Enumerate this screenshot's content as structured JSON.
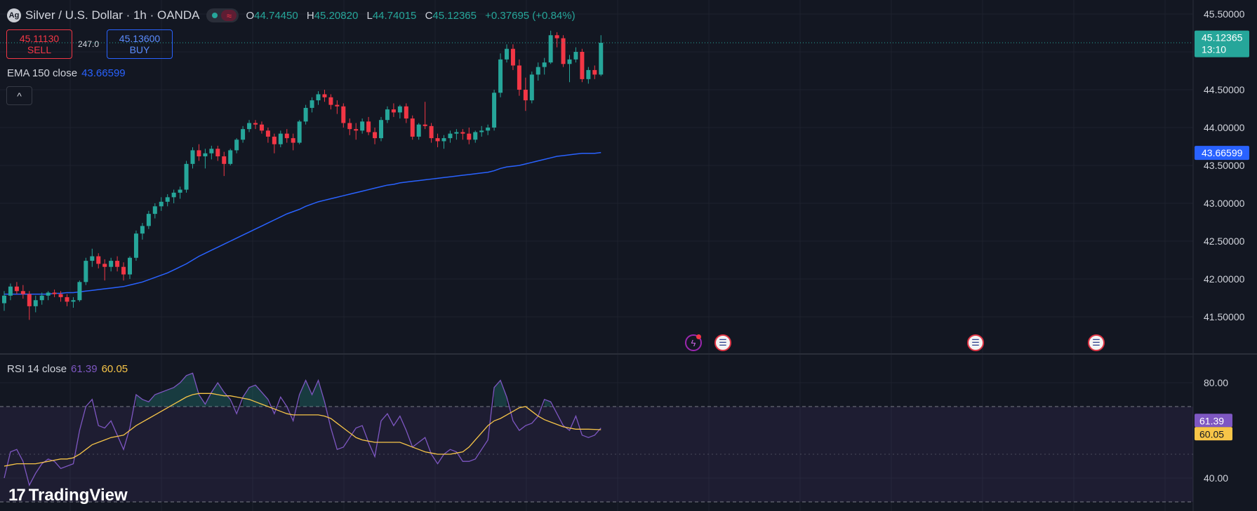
{
  "header": {
    "title": "Silver / U.S. Dollar · 1h · OANDA",
    "ohlc": [
      {
        "k": "O",
        "v": "44.74450"
      },
      {
        "k": "H",
        "v": "45.20820"
      },
      {
        "k": "L",
        "v": "44.74015"
      },
      {
        "k": "C",
        "v": "45.12365"
      }
    ],
    "change": "+0.37695 (+0.84%)"
  },
  "trade": {
    "sell_price": "45.11130",
    "sell_label": "SELL",
    "spread": "247.0",
    "buy_price": "45.13600",
    "buy_label": "BUY"
  },
  "legend": {
    "ema_label": "EMA 150 close",
    "ema_value": "43.66599",
    "rsi_label": "RSI 14 close",
    "rsi_value": "61.39",
    "rsi_ma_value": "60.05"
  },
  "collapse_label": "^",
  "brand": "TradingView",
  "colors": {
    "background": "#131722",
    "up": "#26a69a",
    "down": "#f23645",
    "ema": "#2962ff",
    "rsi": "#7e57c2",
    "rsi_ma": "#f7c548"
  },
  "events": [
    "lightning-icon",
    "us-flag-icon",
    "us-flag-icon",
    "us-flag-icon"
  ],
  "chart_data": [
    {
      "type": "candlestick",
      "title": "Silver / U.S. Dollar · 1h · OANDA",
      "y_ticks": [
        "45.50000",
        "45.00000",
        "44.50000",
        "44.00000",
        "43.50000",
        "43.00000",
        "42.50000",
        "42.00000",
        "41.50000"
      ],
      "ylim": [
        41.1,
        45.65
      ],
      "price_tag": {
        "value": "45.12365",
        "countdown": "13:10"
      },
      "ema_tag": "43.66599",
      "grid": true,
      "candles": [
        [
          41.68,
          41.84,
          41.58,
          41.78
        ],
        [
          41.78,
          41.94,
          41.72,
          41.9
        ],
        [
          41.9,
          41.96,
          41.8,
          41.84
        ],
        [
          41.84,
          41.92,
          41.74,
          41.8
        ],
        [
          41.8,
          41.84,
          41.46,
          41.64
        ],
        [
          41.64,
          41.78,
          41.56,
          41.72
        ],
        [
          41.72,
          41.82,
          41.66,
          41.78
        ],
        [
          41.78,
          41.84,
          41.72,
          41.82
        ],
        [
          41.82,
          41.86,
          41.76,
          41.8
        ],
        [
          41.8,
          41.84,
          41.7,
          41.76
        ],
        [
          41.76,
          41.8,
          41.64,
          41.7
        ],
        [
          41.7,
          41.76,
          41.62,
          41.72
        ],
        [
          41.72,
          41.98,
          41.7,
          41.96
        ],
        [
          41.96,
          42.28,
          41.92,
          42.24
        ],
        [
          42.24,
          42.4,
          42.16,
          42.3
        ],
        [
          42.3,
          42.34,
          42.14,
          42.2
        ],
        [
          42.2,
          42.26,
          41.98,
          42.16
        ],
        [
          42.16,
          42.28,
          42.1,
          42.24
        ],
        [
          42.24,
          42.3,
          42.1,
          42.16
        ],
        [
          42.16,
          42.22,
          41.98,
          42.06
        ],
        [
          42.06,
          42.3,
          42.0,
          42.28
        ],
        [
          42.28,
          42.64,
          42.24,
          42.6
        ],
        [
          42.6,
          42.74,
          42.52,
          42.7
        ],
        [
          42.7,
          42.9,
          42.66,
          42.86
        ],
        [
          42.86,
          43.0,
          42.8,
          42.96
        ],
        [
          42.96,
          43.08,
          42.9,
          43.02
        ],
        [
          43.02,
          43.12,
          42.96,
          43.08
        ],
        [
          43.08,
          43.18,
          43.0,
          43.14
        ],
        [
          43.14,
          43.22,
          43.06,
          43.18
        ],
        [
          43.18,
          43.56,
          43.14,
          43.52
        ],
        [
          43.52,
          43.74,
          43.46,
          43.7
        ],
        [
          43.7,
          43.78,
          43.56,
          43.62
        ],
        [
          43.62,
          43.72,
          43.46,
          43.66
        ],
        [
          43.66,
          43.76,
          43.58,
          43.72
        ],
        [
          43.72,
          43.76,
          43.56,
          43.62
        ],
        [
          43.62,
          43.68,
          43.36,
          43.52
        ],
        [
          43.52,
          43.72,
          43.5,
          43.7
        ],
        [
          43.7,
          43.86,
          43.66,
          43.84
        ],
        [
          43.84,
          44.02,
          43.8,
          43.98
        ],
        [
          43.98,
          44.1,
          43.94,
          44.06
        ],
        [
          44.06,
          44.1,
          43.98,
          44.04
        ],
        [
          44.04,
          44.08,
          43.92,
          43.96
        ],
        [
          43.96,
          44.0,
          43.8,
          43.88
        ],
        [
          43.88,
          43.92,
          43.66,
          43.78
        ],
        [
          43.78,
          43.96,
          43.74,
          43.92
        ],
        [
          43.92,
          43.98,
          43.8,
          43.86
        ],
        [
          43.86,
          43.92,
          43.7,
          43.8
        ],
        [
          43.8,
          44.1,
          43.78,
          44.08
        ],
        [
          44.08,
          44.3,
          44.04,
          44.26
        ],
        [
          44.26,
          44.4,
          44.2,
          44.36
        ],
        [
          44.36,
          44.48,
          44.3,
          44.44
        ],
        [
          44.44,
          44.5,
          44.34,
          44.4
        ],
        [
          44.4,
          44.44,
          44.24,
          44.3
        ],
        [
          44.3,
          44.36,
          44.18,
          44.28
        ],
        [
          44.28,
          44.32,
          44.0,
          44.06
        ],
        [
          44.06,
          44.12,
          43.9,
          43.98
        ],
        [
          43.98,
          44.06,
          43.84,
          43.96
        ],
        [
          43.96,
          44.12,
          43.92,
          44.08
        ],
        [
          44.08,
          44.14,
          43.9,
          43.94
        ],
        [
          43.94,
          44.0,
          43.78,
          43.86
        ],
        [
          43.86,
          44.14,
          43.82,
          44.1
        ],
        [
          44.1,
          44.28,
          44.06,
          44.24
        ],
        [
          44.24,
          44.32,
          44.14,
          44.2
        ],
        [
          44.2,
          44.3,
          44.12,
          44.28
        ],
        [
          44.28,
          44.32,
          44.06,
          44.12
        ],
        [
          44.12,
          44.16,
          43.84,
          43.88
        ],
        [
          43.88,
          44.06,
          43.84,
          44.04
        ],
        [
          44.04,
          44.34,
          43.98,
          44.02
        ],
        [
          44.02,
          44.06,
          43.8,
          43.86
        ],
        [
          43.86,
          43.92,
          43.74,
          43.82
        ],
        [
          43.82,
          43.9,
          43.72,
          43.86
        ],
        [
          43.86,
          43.96,
          43.8,
          43.92
        ],
        [
          43.92,
          43.98,
          43.84,
          43.94
        ],
        [
          43.94,
          43.98,
          43.84,
          43.92
        ],
        [
          43.92,
          44.0,
          43.78,
          43.84
        ],
        [
          43.84,
          43.96,
          43.8,
          43.94
        ],
        [
          43.94,
          44.02,
          43.88,
          43.96
        ],
        [
          43.96,
          44.04,
          43.9,
          44.0
        ],
        [
          44.0,
          44.5,
          43.96,
          44.46
        ],
        [
          44.46,
          44.98,
          44.4,
          44.9
        ],
        [
          44.9,
          45.1,
          44.86,
          45.04
        ],
        [
          45.04,
          45.1,
          44.76,
          44.82
        ],
        [
          44.82,
          44.9,
          44.42,
          44.5
        ],
        [
          44.5,
          44.66,
          44.22,
          44.36
        ],
        [
          44.36,
          44.74,
          44.32,
          44.7
        ],
        [
          44.7,
          44.86,
          44.62,
          44.8
        ],
        [
          44.8,
          44.92,
          44.7,
          44.86
        ],
        [
          44.86,
          45.28,
          44.84,
          45.22
        ],
        [
          45.22,
          45.26,
          45.06,
          45.18
        ],
        [
          45.18,
          45.22,
          44.8,
          44.84
        ],
        [
          44.84,
          44.96,
          44.6,
          44.9
        ],
        [
          44.9,
          45.06,
          44.86,
          45.0
        ],
        [
          45.0,
          45.04,
          44.6,
          44.64
        ],
        [
          44.64,
          44.8,
          44.58,
          44.76
        ],
        [
          44.76,
          44.82,
          44.64,
          44.7
        ],
        [
          44.7,
          45.22,
          44.68,
          45.12
        ]
      ],
      "ema": [
        41.8,
        41.8,
        41.8,
        41.8,
        41.8,
        41.8,
        41.8,
        41.8,
        41.81,
        41.81,
        41.82,
        41.82,
        41.83,
        41.84,
        41.85,
        41.86,
        41.87,
        41.88,
        41.89,
        41.9,
        41.92,
        41.94,
        41.96,
        41.99,
        42.02,
        42.05,
        42.08,
        42.12,
        42.16,
        42.2,
        42.25,
        42.3,
        42.34,
        42.38,
        42.42,
        42.46,
        42.5,
        42.54,
        42.58,
        42.62,
        42.66,
        42.7,
        42.74,
        42.78,
        42.82,
        42.86,
        42.89,
        42.92,
        42.96,
        42.99,
        43.02,
        43.04,
        43.06,
        43.08,
        43.1,
        43.12,
        43.14,
        43.16,
        43.18,
        43.2,
        43.22,
        43.24,
        43.25,
        43.27,
        43.28,
        43.29,
        43.3,
        43.31,
        43.32,
        43.33,
        43.34,
        43.35,
        43.36,
        43.37,
        43.38,
        43.39,
        43.4,
        43.41,
        43.43,
        43.46,
        43.48,
        43.49,
        43.5,
        43.52,
        43.54,
        43.56,
        43.58,
        43.6,
        43.62,
        43.63,
        43.64,
        43.65,
        43.66,
        43.66,
        43.66,
        43.67
      ]
    },
    {
      "type": "line",
      "title": "RSI 14 close",
      "y_ticks": [
        "80.00",
        "40.00"
      ],
      "ylim": [
        33,
        87
      ],
      "bands": [
        70,
        30
      ],
      "rsi_tag": "61.39",
      "ma_tag": "60.05",
      "series": [
        {
          "name": "RSI 14 close",
          "values": [
            40,
            51,
            52,
            47,
            37,
            42,
            46,
            48,
            47,
            44,
            45,
            46,
            60,
            70,
            73,
            62,
            61,
            64,
            58,
            52,
            61,
            75,
            73,
            72,
            75,
            76,
            77,
            78,
            80,
            83,
            84,
            75,
            71,
            76,
            80,
            76,
            73,
            67,
            74,
            78,
            79,
            76,
            73,
            67,
            74,
            70,
            64,
            75,
            81,
            75,
            81,
            72,
            61,
            52,
            53,
            57,
            61,
            62,
            55,
            49,
            64,
            67,
            62,
            66,
            60,
            53,
            55,
            57,
            50,
            46,
            50,
            52,
            51,
            47,
            47,
            48,
            52,
            56,
            78,
            81,
            74,
            64,
            60,
            62,
            63,
            66,
            73,
            72,
            67,
            62,
            60,
            66,
            58,
            57,
            58,
            61
          ]
        },
        {
          "name": "RSI MA",
          "values": [
            45,
            45.5,
            46,
            46,
            46,
            46,
            46.5,
            47,
            47.5,
            48,
            48,
            48.5,
            50,
            52,
            54,
            55,
            56,
            57,
            57.5,
            58,
            60,
            62,
            63.5,
            65,
            66.5,
            68,
            69.5,
            71,
            72.5,
            74,
            75,
            75.5,
            75.5,
            75.5,
            75,
            74.5,
            74.5,
            74,
            73.5,
            73,
            72,
            71,
            70,
            69,
            68,
            67,
            66.5,
            66.5,
            66.5,
            66.5,
            66.5,
            66,
            65,
            63,
            61,
            59,
            57,
            56,
            55.5,
            55,
            55,
            55,
            55,
            55,
            54,
            53,
            52,
            51,
            50.5,
            50,
            50,
            50,
            50.5,
            51,
            53,
            56,
            59,
            62,
            64,
            65,
            66.5,
            68,
            69.5,
            70,
            68,
            66,
            64.5,
            63.5,
            62.5,
            61.5,
            61,
            60.5,
            60.5,
            60.5,
            60.4,
            60.3
          ]
        }
      ]
    }
  ]
}
